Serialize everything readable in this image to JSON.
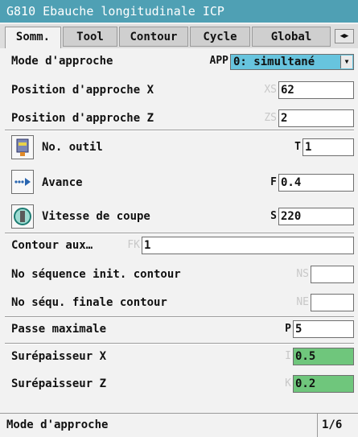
{
  "window": {
    "title": "G810 Ebauche longitudinale ICP"
  },
  "tabs": [
    "Somm.",
    "Tool",
    "Contour",
    "Cycle",
    "Global"
  ],
  "approach": {
    "mode_label": "Mode d'approche",
    "mode_addr": "APP",
    "mode_value": "0: simultané",
    "pos_x_label": "Position d'approche X",
    "pos_x_addr": "XS",
    "pos_x_value": "62",
    "pos_z_label": "Position d'approche Z",
    "pos_z_addr": "ZS",
    "pos_z_value": "2"
  },
  "tool": {
    "no_label": "No. outil",
    "no_addr": "T",
    "no_value": "1",
    "feed_label": "Avance",
    "feed_addr": "F",
    "feed_value": "0.4",
    "speed_label": "Vitesse de coupe",
    "speed_addr": "S",
    "speed_value": "220"
  },
  "contour": {
    "aux_label": "Contour aux…",
    "aux_addr": "FK",
    "aux_value": "1",
    "start_label": "No séquence init. contour",
    "start_addr": "NS",
    "start_value": "",
    "end_label": "No séqu. finale contour",
    "end_addr": "NE",
    "end_value": ""
  },
  "machining": {
    "pass_label": "Passe maximale",
    "pass_addr": "P",
    "pass_value": "5",
    "allow_x_label": "Surépaisseur X",
    "allow_x_addr": "I",
    "allow_x_value": "0.5",
    "allow_z_label": "Surépaisseur Z",
    "allow_z_addr": "K",
    "allow_z_value": "0.2"
  },
  "status": {
    "message": "Mode d'approche",
    "page": "1/6"
  },
  "colors": {
    "title_bar": "#4fa0b4",
    "select_bg": "#67c4de",
    "highlight_field": "#6fc67c"
  }
}
